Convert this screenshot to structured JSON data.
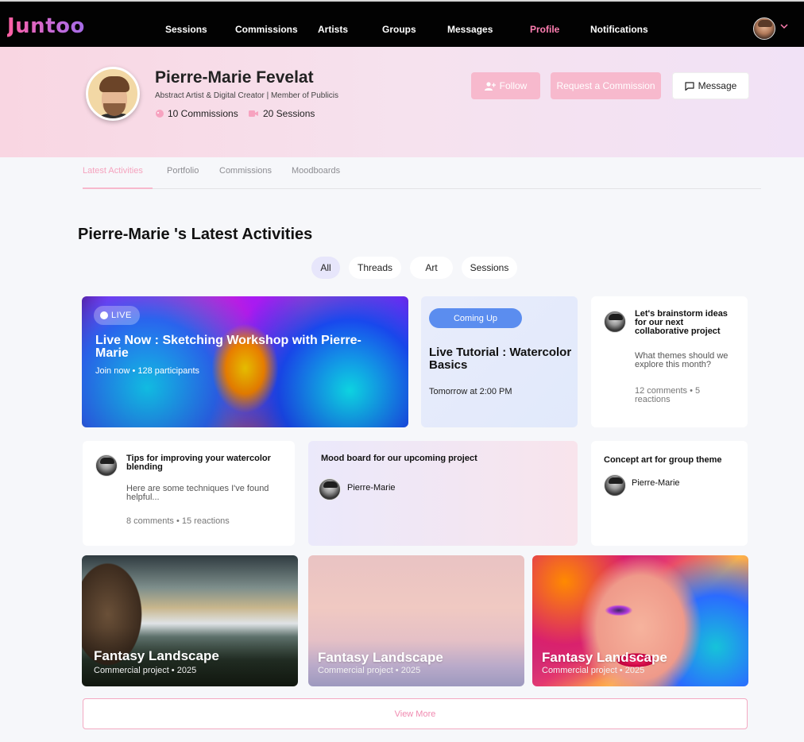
{
  "nav": {
    "logo": "Juntoo",
    "items": [
      {
        "label": "Sessions"
      },
      {
        "label": "Commissions"
      },
      {
        "label": "Artists"
      },
      {
        "label": "Groups"
      },
      {
        "label": "Messages"
      },
      {
        "label": "Profile",
        "active": true
      },
      {
        "label": "Notifications"
      }
    ]
  },
  "profile": {
    "name": "Pierre-Marie Fevelat",
    "subtitle": "Abstract Artist & Digital Creator | Member of Publicis",
    "commissions_stat": "10 Commissions",
    "sessions_stat": "20 Sessions",
    "follow_label": "Follow",
    "request_label": "Request a Commission",
    "message_label": "Message"
  },
  "tabs": [
    "Latest Activities",
    "Portfolio",
    "Commissions",
    "Moodboards"
  ],
  "activities": {
    "title": "Pierre-Marie 's Latest Activities",
    "filters": [
      "All",
      "Threads",
      "Art",
      "Sessions"
    ],
    "live": {
      "badge": "LIVE",
      "title": "Live Now : Sketching Workshop with Pierre-Marie",
      "meta": "Join now • 128 participants"
    },
    "coming": {
      "badge": "Coming Up",
      "title": "Live Tutorial : Watercolor Basics",
      "time": "Tomorrow at 2:00 PM"
    },
    "thread1": {
      "title": "Let's brainstorm ideas for our next collaborative project",
      "body": "What themes should we explore this month?",
      "meta": "12 comments • 5 reactions"
    },
    "thread2": {
      "title": "Tips for improving your watercolor blending",
      "body": "Here are some techniques I've found helpful...",
      "meta": "8 comments • 15 reactions"
    },
    "mood": {
      "title": "Mood board for our upcoming project",
      "author": "Pierre-Marie"
    },
    "concept": {
      "title": "Concept art for group theme",
      "author": "Pierre-Marie"
    },
    "portfolio": [
      {
        "title": "Fantasy Landscape",
        "meta": "Commercial project  • 2025"
      },
      {
        "title": "Fantasy Landscape",
        "meta": "Commercial project  • 2025"
      },
      {
        "title": "Fantasy Landscape",
        "meta": "Commercial project  • 2025"
      }
    ],
    "view_more": "View More"
  },
  "colors": {
    "accent": "#f7b9cd",
    "nav_active": "#ff7fb2",
    "coming_pill": "#5b8def",
    "nav_bg": "#020202"
  },
  "icons": {
    "follow": "person-plus-icon",
    "message": "chat-bubble-icon",
    "commissions": "palette-icon",
    "sessions": "video-camera-icon",
    "caret": "chevron-down-icon",
    "live": "live-dot-icon"
  }
}
